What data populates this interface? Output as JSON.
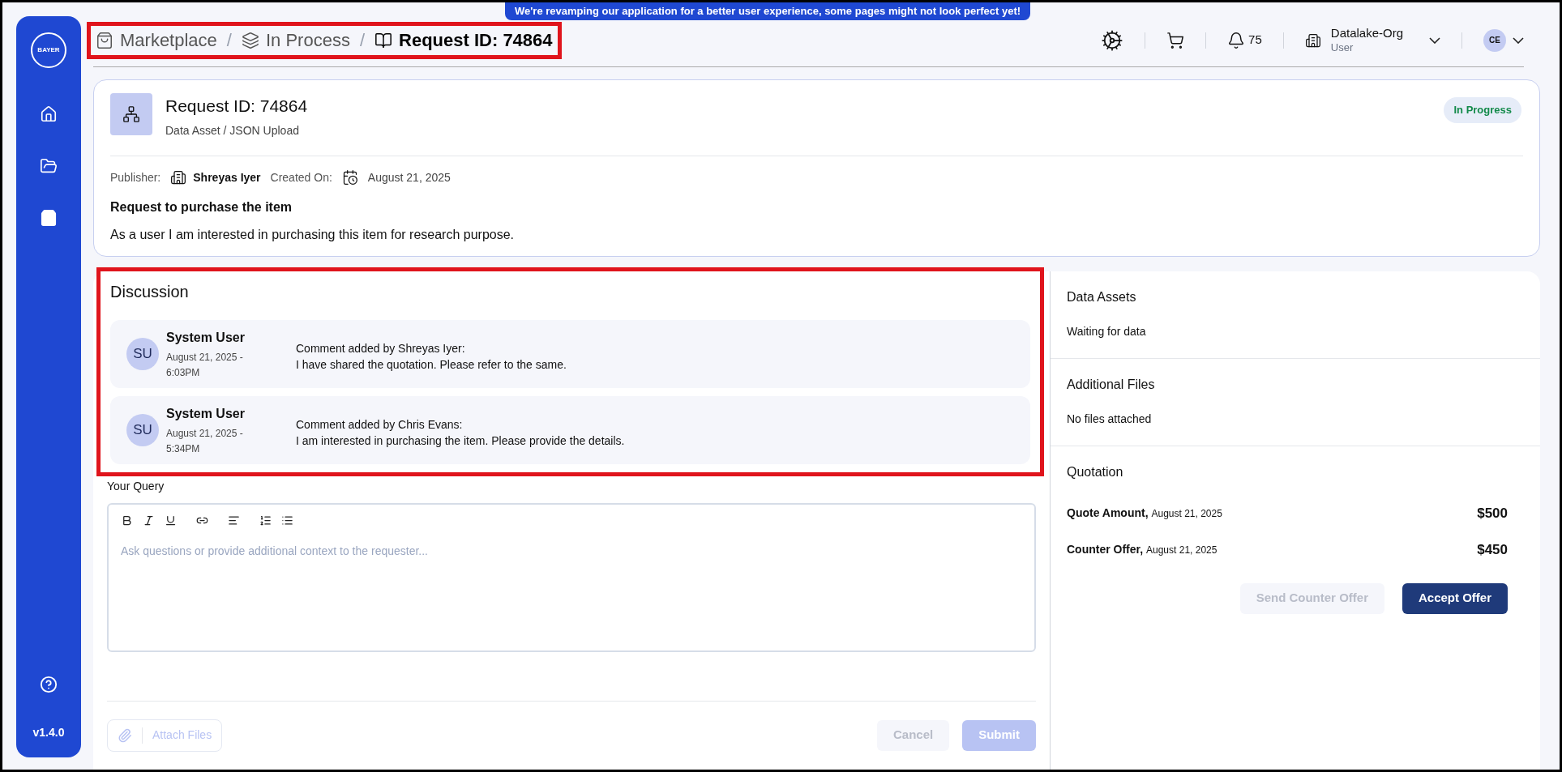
{
  "banner": "We're revamping our application for a better user experience, some pages might not look perfect yet!",
  "sidebar": {
    "logo": "BAYER",
    "items": [
      {
        "selected": false
      },
      {
        "selected": false
      },
      {
        "selected": true
      }
    ],
    "version": "v1.4.0"
  },
  "breadcrumb": [
    {
      "label": "Marketplace",
      "current": false
    },
    {
      "separator": "/",
      "label": "In Process",
      "current": false
    },
    {
      "separator": "/",
      "label": "Request ID: 74864",
      "current": true
    }
  ],
  "header": {
    "notifications": "75",
    "org": "Datalake-Org",
    "role": "User",
    "avatar": "CE"
  },
  "request": {
    "title": "Request ID: 74864",
    "subtitle": "Data Asset / JSON Upload",
    "status": "In Progress",
    "publisher_label": "Publisher:",
    "publisher": "Shreyas Iyer",
    "created_label": "Created On:",
    "created": "August 21, 2025",
    "heading": "Request to purchase the item",
    "description": "As a user I am interested in purchasing this item for research purpose."
  },
  "discussion": {
    "title": "Discussion",
    "comments": [
      {
        "avatar": "SU",
        "author": "System User",
        "time": "August 21, 2025 - 6:03PM",
        "header": "Comment added by Shreyas Iyer:",
        "text": "I have shared the quotation. Please refer to the same."
      },
      {
        "avatar": "SU",
        "author": "System User",
        "time": "August 21, 2025 - 5:34PM",
        "header": "Comment added by Chris Evans:",
        "text": "I am interested in purchasing the item. Please provide the details."
      }
    ],
    "query_label": "Your Query",
    "placeholder": "Ask questions or provide additional context to the requester...",
    "attach": {
      "label": "Attach Files",
      "disabled": true
    },
    "cancel": {
      "label": "Cancel",
      "disabled": true
    },
    "submit": {
      "label": "Submit",
      "disabled": true
    }
  },
  "side": {
    "data_assets": {
      "title": "Data Assets",
      "text": "Waiting for data"
    },
    "files": {
      "title": "Additional Files",
      "text": "No files attached"
    },
    "quotation": {
      "title": "Quotation",
      "rows": [
        {
          "label": "Quote Amount,",
          "date": "August 21, 2025",
          "amount": "$500"
        },
        {
          "label": "Counter Offer,",
          "date": "August 21, 2025",
          "amount": "$450"
        }
      ],
      "buttons": [
        {
          "label": "Send Counter Offer",
          "disabled": true
        },
        {
          "label": "Accept Offer",
          "disabled": false
        }
      ]
    }
  }
}
